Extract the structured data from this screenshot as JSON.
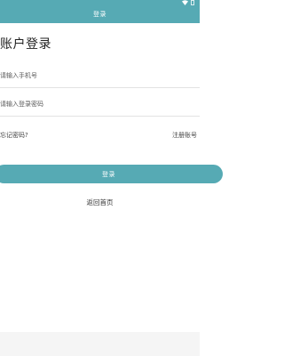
{
  "status_bar": {
    "icons": [
      "wifi-icon",
      "battery-icon"
    ]
  },
  "header": {
    "title": "登录"
  },
  "page": {
    "heading": "账户登录"
  },
  "form": {
    "phone_placeholder": "请输入手机号",
    "phone_value": "",
    "password_placeholder": "请输入登录密码",
    "password_value": ""
  },
  "links": {
    "forgot_password": "忘记密码?",
    "register": "注册账号",
    "home": "返回首页"
  },
  "actions": {
    "login_label": "登录"
  },
  "colors": {
    "accent": "#56aab4",
    "background": "#ffffff",
    "bottom_bar": "#f5f5f5"
  }
}
